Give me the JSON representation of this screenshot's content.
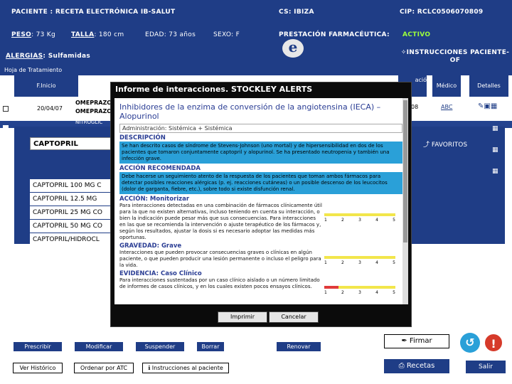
{
  "header": {
    "patient": "PACIENTE : RECETA ELECTRÓNICA IB-SALUT",
    "cs": "CS: IBIZA",
    "cip": "CIP: RCLC0506070809",
    "peso_label": "PESO",
    "peso_value": ": 73 Kg",
    "talla_label": "TALLA",
    "talla_value": ": 180 cm",
    "edad": "EDAD: 73 años",
    "sexo": "SEXO: F",
    "prestacion": "PRESTACIÓN FARMACÉUTICA:",
    "activo": "ACTIVO",
    "alergias_label": "ALERGIAS",
    "alergias_value": ": Sulfamidas",
    "instrucciones": "INSTRUCCIONES PACIENTE-OF",
    "e_logo": "e"
  },
  "strip": {
    "label": "Hoja de Tratamiento"
  },
  "columns": {
    "inicio": "F.Inicio",
    "duracion": "ació",
    "medico": "Médico",
    "detalles": "Detalles"
  },
  "rows": [
    {
      "date": "20/04/07",
      "drug1": "OMEPRAZO",
      "drug2": "OMEPRAZOL",
      "med_extra": "08",
      "medico": "ABC"
    },
    {
      "drug1": "NITROGLIC"
    }
  ],
  "captopril_search": "CAPTOPRIL",
  "favoritos": "FAVORITOS",
  "captopril_list": [
    "CAPTOPRIL 100 MG C",
    "CAPTOPRIL  12.5 MG",
    "CAPTOPRIL 25 MG CO",
    "CAPTOPRIL 50 MG CO",
    "CAPTOPRIL/HIDROCL"
  ],
  "dialog": {
    "title": "Informe de interacciones. STOCKLEY ALERTS",
    "heading": "Inhibidores de la enzima de conversión de la angiotensina (IECA) – Alopurinol",
    "admin": "Administración: Sistémica + Sistémica",
    "desc_label": "DESCRIPCIÓN",
    "desc_text": "Se han descrito casos de síndrome de Stevens-Johnson (uno mortal) y de hipersensibilidad en dos de los pacientes que tomaron conjuntamente captopril y alopurinol. Se ha presentado neutropenia y también una infección grave.",
    "accion_label": "ACCIÓN RECOMENDADA",
    "accion_text": "Debe hacerse un seguimiento atento de la respuesta de los pacientes que toman ambos fármacos para detectar posibles reacciones alérgicas (p. ej. reacciones cutáneas) o un posible descenso de los leucocitos (dolor de garganta, fiebre, etc.), sobre todo si existe disfunción renal.",
    "monitor_label": "ACCIÓN: Monitorizar",
    "monitor_text": "Para interacciones detectadas en una combinación de fármacos clínicamente útil para la que no existen alternativas, incluso teniendo en cuenta su interacción, o bien la indicación puede pesar más que sus consecuencias. Para interacciones en las que se recomienda la intervención o ajuste terapéutico de los fármacos y, según los resultados, ajustar la dosis si es necesario adoptar las medidas más oportunas.",
    "gravedad_label": "GRAVEDAD: Grave",
    "gravedad_text": "Interacciones que pueden provocar consecuencias graves o clínicas en algún paciente, o que pueden producir una lesión permanente o incluso el peligro para la vida.",
    "evidencia_label": "EVIDENCIA: Caso Clínico",
    "evidencia_text": "Para interacciones sustentadas por un caso clínico aislado o un número limitado de informes de casos clínicos, y en los cuales existen pocos ensayos clínicos.",
    "scale": [
      "1",
      "2",
      "3",
      "4",
      "5"
    ],
    "btn_print": "Imprimir",
    "btn_cancel": "Cancelar"
  },
  "bottom": {
    "prescribir": "Prescribir",
    "modificar": "Modificar",
    "suspender": "Suspender",
    "borrar": "Borrar",
    "renovar": "Renovar",
    "historico": "Ver Histórico",
    "ordenar": "Ordenar por ATC",
    "instrucciones": "Instrucciones al paciente",
    "firmar": "Firmar",
    "recetas": "Recetas",
    "salir": "Salir"
  }
}
